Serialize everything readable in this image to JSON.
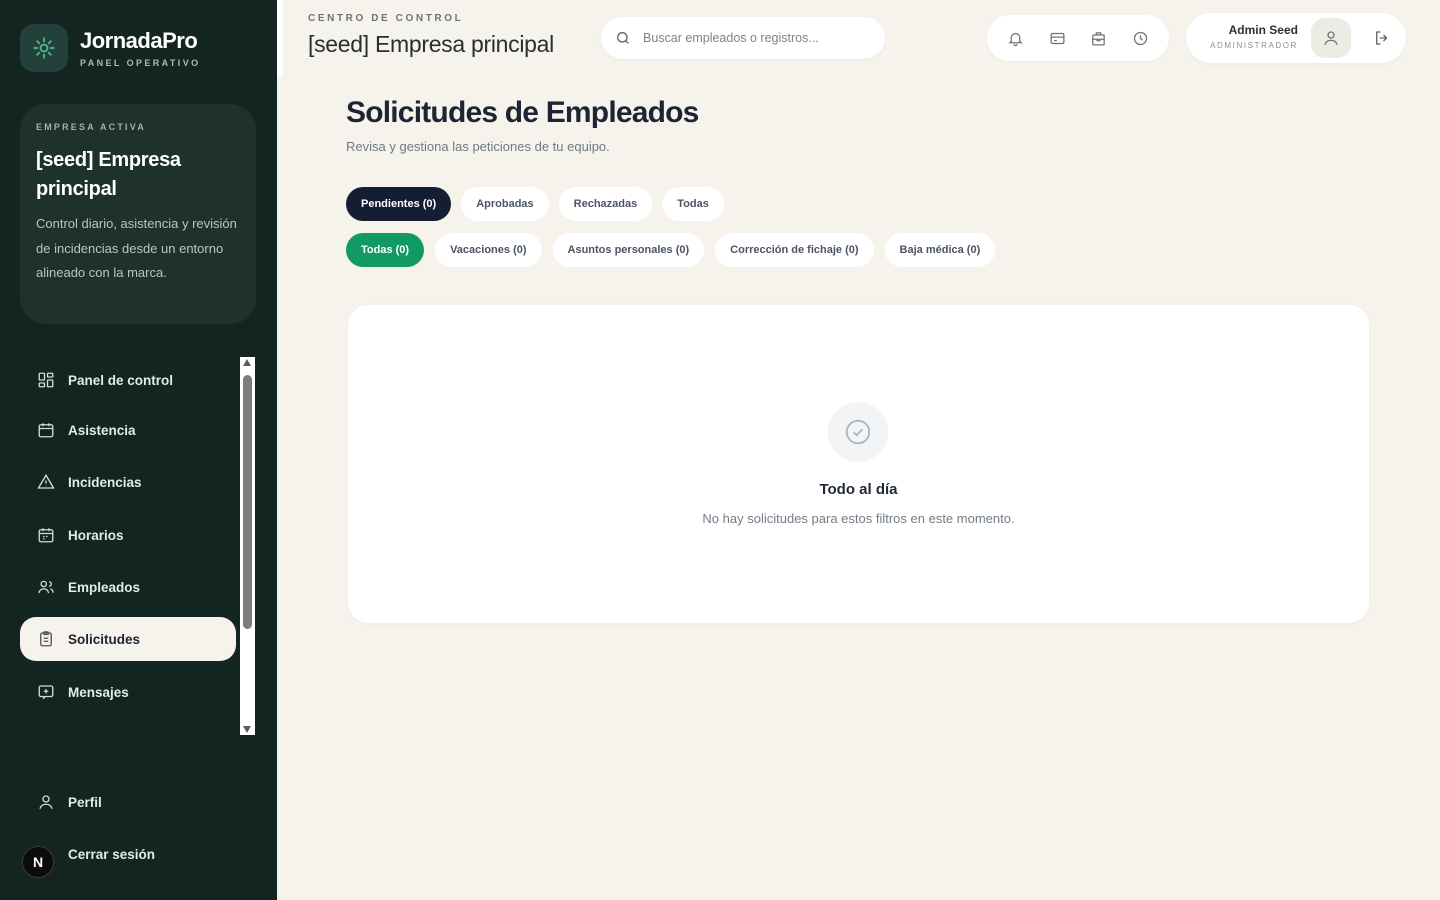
{
  "brand": {
    "name": "JornadaPro",
    "subtitle": "PANEL OPERATIVO"
  },
  "company_card": {
    "kicker": "EMPRESA ACTIVA",
    "name": "[seed] Empresa principal",
    "description": "Control diario, asistencia y revisión de incidencias desde un entorno alineado con la marca."
  },
  "sidebar": {
    "items": [
      {
        "label": "Panel de control",
        "icon": "dashboard-icon"
      },
      {
        "label": "Asistencia",
        "icon": "calendar-icon"
      },
      {
        "label": "Incidencias",
        "icon": "warning-icon"
      },
      {
        "label": "Horarios",
        "icon": "schedule-icon"
      },
      {
        "label": "Empleados",
        "icon": "users-icon"
      },
      {
        "label": "Solicitudes",
        "icon": "clipboard-icon",
        "active": true
      },
      {
        "label": "Mensajes",
        "icon": "message-icon"
      }
    ],
    "bottom": [
      {
        "label": "Perfil",
        "icon": "user-icon"
      },
      {
        "label": "Cerrar sesión",
        "icon": "logout-icon"
      }
    ],
    "badge_letter": "N"
  },
  "header": {
    "kicker": "CENTRO DE CONTROL",
    "title": "[seed] Empresa principal",
    "search_placeholder": "Buscar empleados o registros...",
    "icons": [
      "bell-icon",
      "card-icon",
      "building-icon",
      "clock-icon"
    ],
    "user": {
      "name": "Admin Seed",
      "role": "ADMINISTRADOR"
    }
  },
  "main": {
    "title": "Solicitudes de Empleados",
    "subtitle": "Revisa y gestiona las peticiones de tu equipo.",
    "status_tabs": [
      {
        "label": "Pendientes (0)",
        "active": true
      },
      {
        "label": "Aprobadas",
        "active": false
      },
      {
        "label": "Rechazadas",
        "active": false
      },
      {
        "label": "Todas",
        "active": false
      }
    ],
    "type_tabs": [
      {
        "label": "Todas (0)",
        "active": true
      },
      {
        "label": "Vacaciones (0)",
        "active": false
      },
      {
        "label": "Asuntos personales (0)",
        "active": false
      },
      {
        "label": "Corrección de fichaje (0)",
        "active": false
      },
      {
        "label": "Baja médica (0)",
        "active": false
      }
    ],
    "empty": {
      "title": "Todo al día",
      "text": "No hay solicitudes para estos filtros en este momento."
    }
  },
  "colors": {
    "sidebar_bg": "#142421",
    "page_bg": "#f6f2ec",
    "active_status_tab": "#141e33",
    "active_type_tab": "#119a63"
  }
}
